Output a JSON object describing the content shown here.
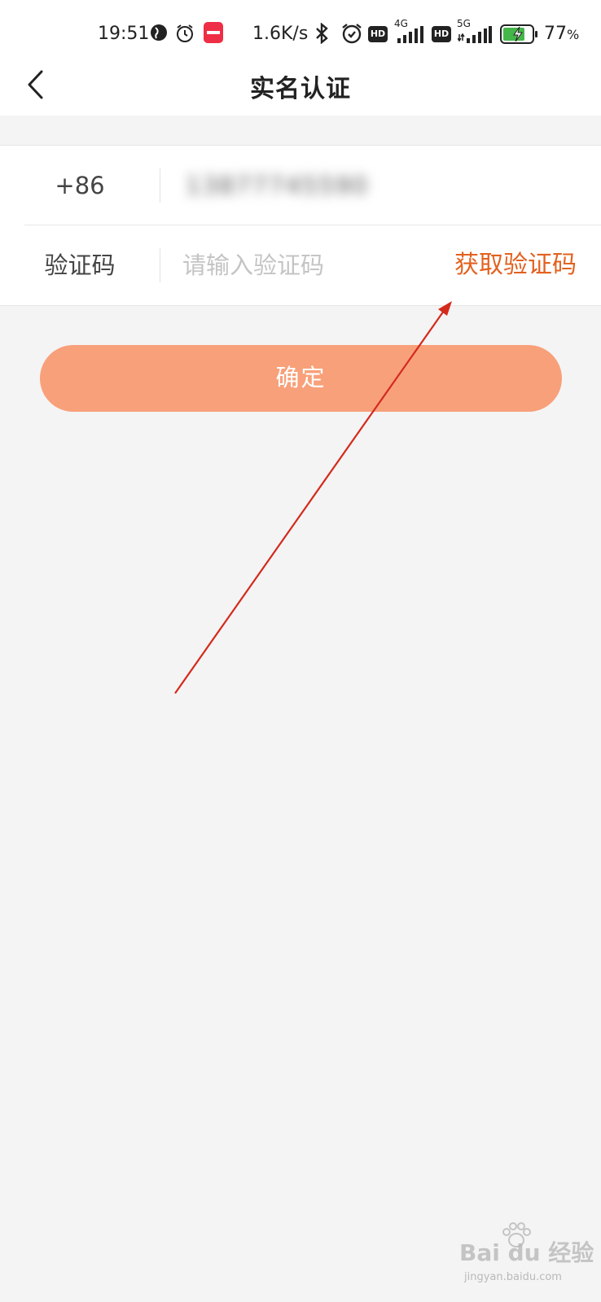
{
  "status_bar": {
    "time": "19:51",
    "net_speed": "1.6K/s",
    "hd_label": "HD",
    "signal1_tech": "4G",
    "signal2_tech": "5G",
    "battery_percent": "77",
    "battery_suffix": "%",
    "app_badge_icon": "app-notification-icon",
    "icons": [
      "globe-icon",
      "alarm-icon",
      "bluetooth-icon",
      "alarm-clock-icon",
      "signal-icon",
      "battery-charging-icon"
    ]
  },
  "header": {
    "title": "实名认证",
    "back_icon": "chevron-left-icon"
  },
  "form": {
    "phone_prefix": "+86",
    "phone_value": "13877745590",
    "code_label": "验证码",
    "code_placeholder": "请输入验证码",
    "get_code_label": "获取验证码"
  },
  "confirm_button": {
    "label": "确定"
  },
  "annotation": {
    "type": "arrow",
    "color": "#d42a1c",
    "points_to": "获取验证码"
  },
  "watermark": {
    "brand": "Bai du 经验",
    "url": "jingyan.baidu.com"
  },
  "colors": {
    "accent": "#e2611f",
    "button": "#f8a07a",
    "background": "#f4f4f4"
  }
}
